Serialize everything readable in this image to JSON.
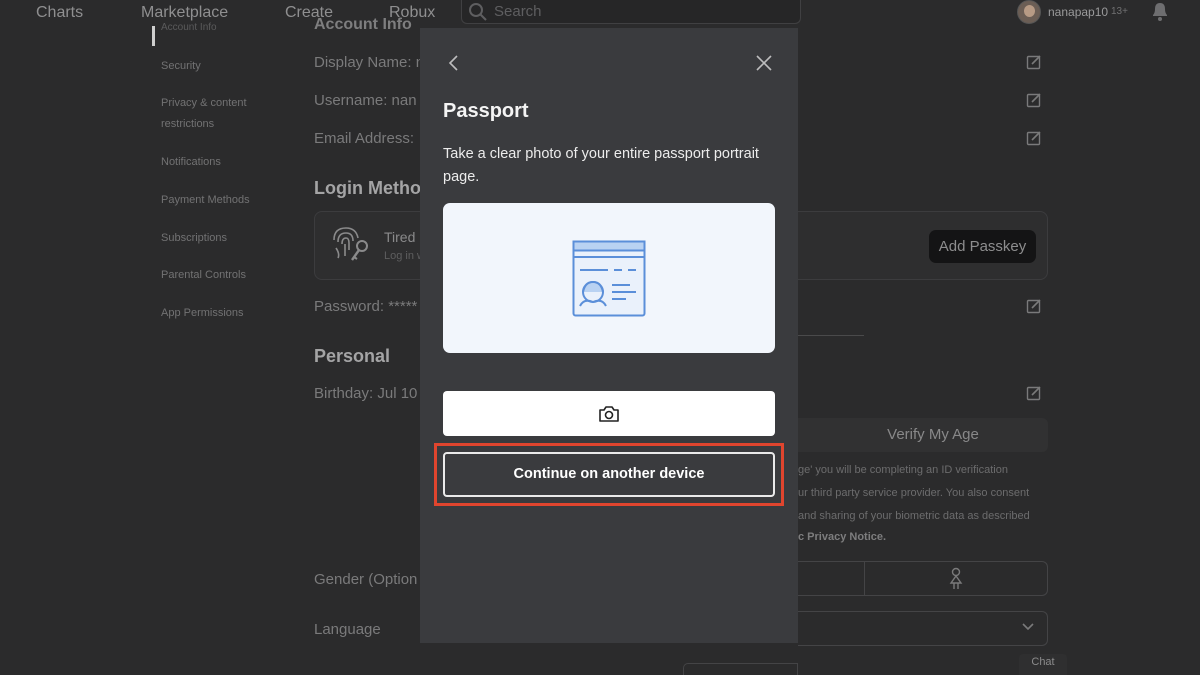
{
  "nav": {
    "links": [
      "Charts",
      "Marketplace",
      "Create",
      "Robux"
    ],
    "search_placeholder": "Search",
    "username": "nanapap10",
    "age_badge": "13+"
  },
  "sidebar": {
    "items": [
      {
        "label": "Account Info",
        "active": true
      },
      {
        "label": "Security"
      },
      {
        "label": "Privacy & content restrictions"
      },
      {
        "label": "Notifications"
      },
      {
        "label": "Payment Methods"
      },
      {
        "label": "Subscriptions"
      },
      {
        "label": "Parental Controls"
      },
      {
        "label": "App Permissions"
      }
    ]
  },
  "background": {
    "account_header": "Account Info",
    "display_name_label": "Display Name: n",
    "username_label": "Username: nan",
    "email_label": "Email Address: ",
    "login_methods_title": "Login Metho",
    "login_item_title": "Tired",
    "login_item_sub": "Log in w",
    "add_passkey": "Add Passkey",
    "password_label": "Password: *****",
    "personal_title": "Personal",
    "birthday_label": "Birthday: Jul 10",
    "verify_age": "Verify My Age",
    "consent_lines": [
      "ge' you will be completing an ID verification",
      "ur third party service provider. You also consent",
      "and sharing of your biometric data as described"
    ],
    "consent_link": "c Privacy Notice.",
    "gender_label": "Gender (Option",
    "language_label": "Language",
    "chat": "Chat"
  },
  "modal": {
    "title": "Passport",
    "description": "Take a clear photo of your entire passport portrait page.",
    "continue_label": "Continue on another device",
    "highlight_color": "#e0452e"
  }
}
